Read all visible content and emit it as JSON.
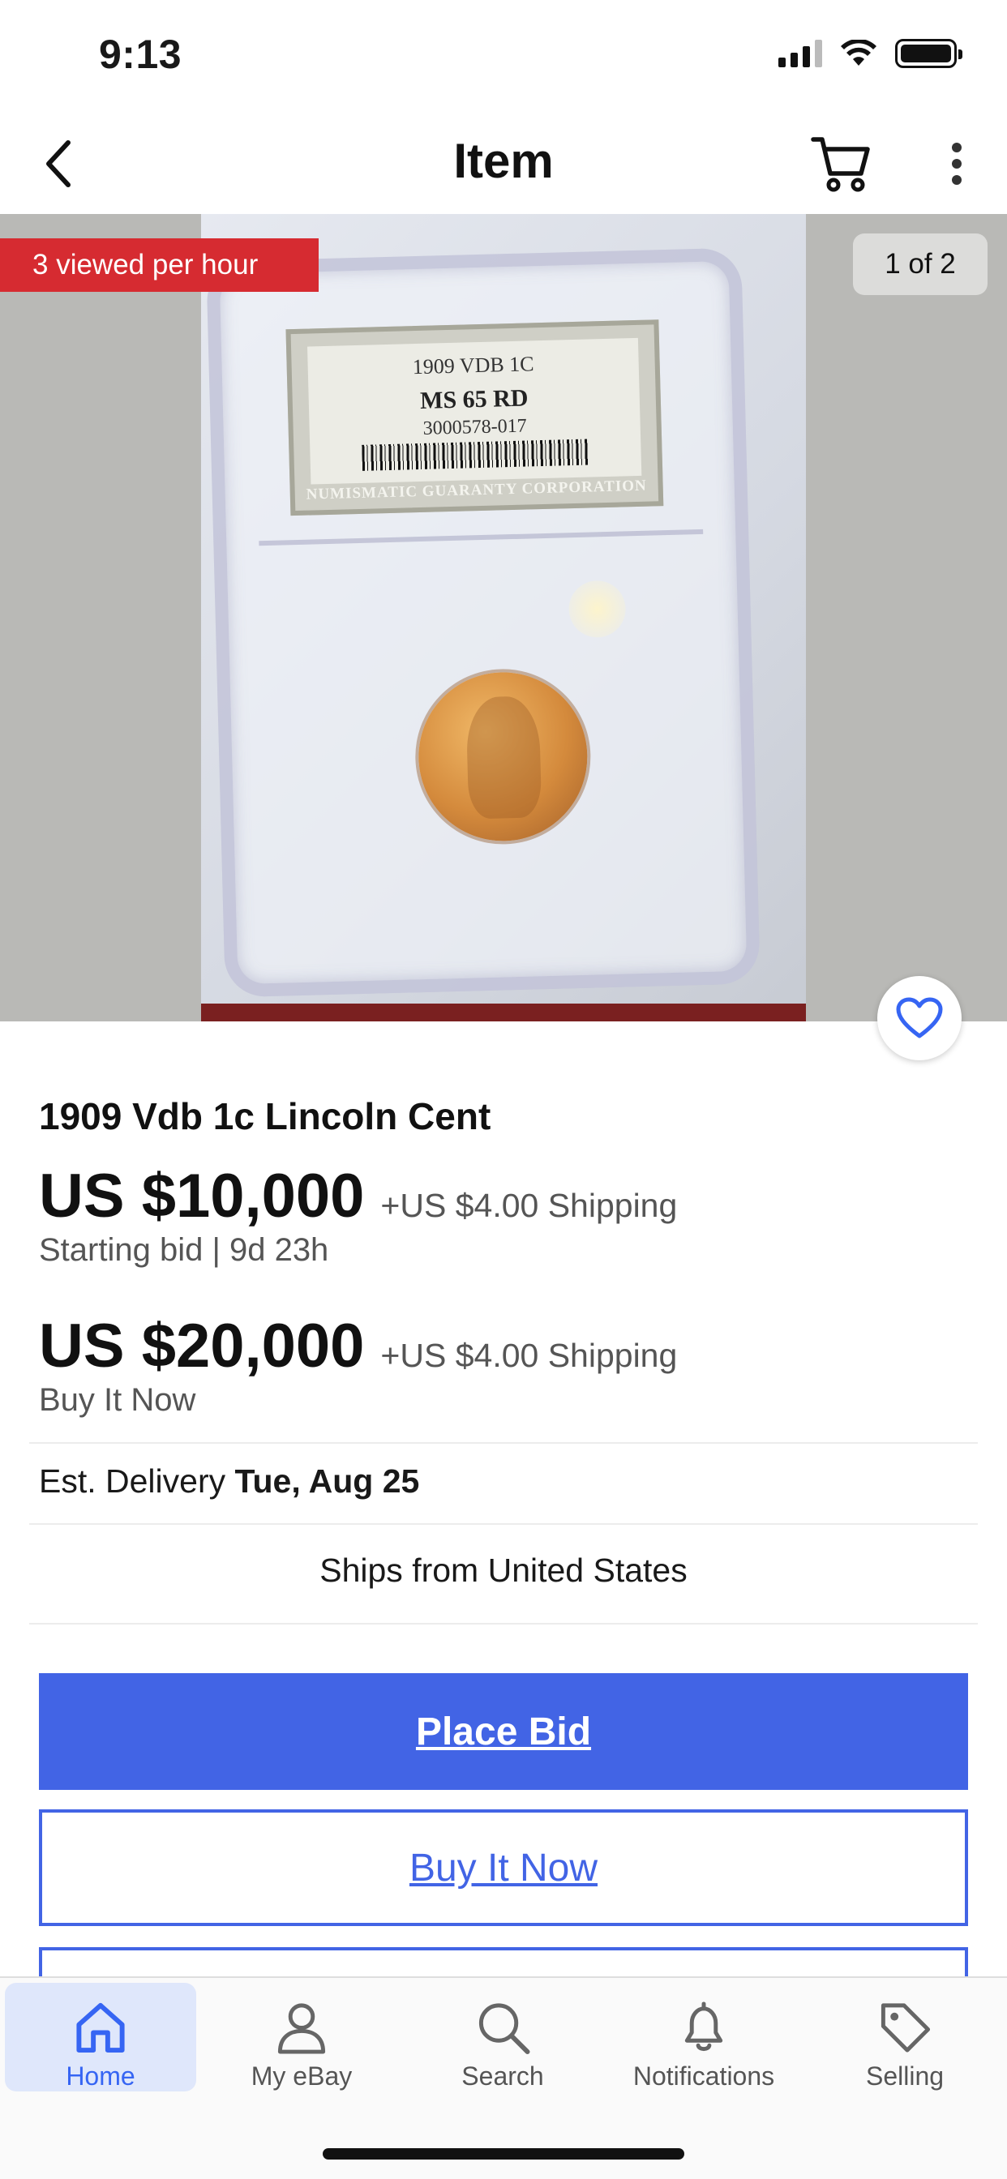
{
  "status_bar": {
    "time": "9:13"
  },
  "nav": {
    "title": "Item"
  },
  "gallery": {
    "views_badge": "3 viewed per hour",
    "counter": "1 of 2",
    "slab_label": {
      "line1": "1909 VDB  1C",
      "grade": "MS 65 RD",
      "cert": "3000578-017",
      "grader": "NUMISMATIC GUARANTY CORPORATION"
    }
  },
  "item": {
    "title": "1909 Vdb 1c Lincoln Cent",
    "bid_price": "US $10,000",
    "bid_shipping": "+US $4.00 Shipping",
    "bid_sub": "Starting bid  |  9d 23h",
    "bin_price": "US $20,000",
    "bin_shipping": "+US $4.00 Shipping",
    "bin_sub": "Buy It Now",
    "est_label": "Est. Delivery ",
    "est_date": "Tue, Aug 25",
    "ships_from": "Ships from United States"
  },
  "actions": {
    "place_bid": "Place Bid",
    "buy_it_now": "Buy It Now"
  },
  "tabs": [
    {
      "label": "Home",
      "icon": "home-icon",
      "active": true
    },
    {
      "label": "My eBay",
      "icon": "person-icon",
      "active": false
    },
    {
      "label": "Search",
      "icon": "search-icon",
      "active": false
    },
    {
      "label": "Notifications",
      "icon": "bell-icon",
      "active": false
    },
    {
      "label": "Selling",
      "icon": "tag-icon",
      "active": false
    }
  ],
  "colors": {
    "accent": "#4264e5",
    "badge": "#d62b31",
    "active_tab": "#3665f3"
  }
}
